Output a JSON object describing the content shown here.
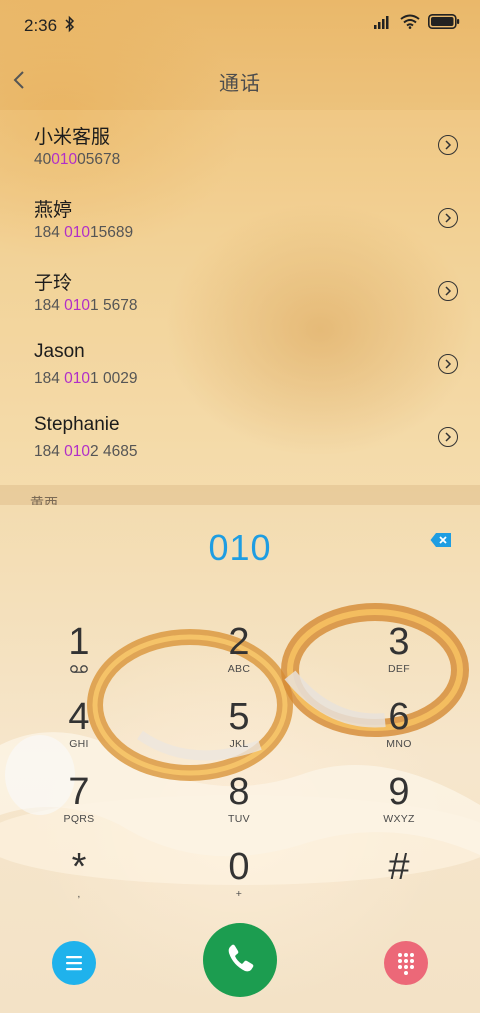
{
  "status_bar": {
    "time": "2:36"
  },
  "header": {
    "title": "通话"
  },
  "contacts": [
    {
      "name": "小米客服",
      "number_pre": "40",
      "number_match": "010",
      "number_post": "05678"
    },
    {
      "name": "燕婷",
      "number_pre": "184 ",
      "number_match": "010",
      "number_post": "15689"
    },
    {
      "name": "子玲",
      "number_pre": "184 ",
      "number_match": "010",
      "number_post": "1 5678"
    },
    {
      "name": "Jason",
      "number_pre": "184 ",
      "number_match": "010",
      "number_post": "1 0029"
    },
    {
      "name": "Stephanie",
      "number_pre": "184 ",
      "number_match": "010",
      "number_post": "2 4685"
    }
  ],
  "section_peek": "黄西",
  "dialer": {
    "display": "010",
    "keys": [
      {
        "digit": "1",
        "letters": ""
      },
      {
        "digit": "2",
        "letters": "ABC"
      },
      {
        "digit": "3",
        "letters": "DEF"
      },
      {
        "digit": "4",
        "letters": "GHI"
      },
      {
        "digit": "5",
        "letters": "JKL"
      },
      {
        "digit": "6",
        "letters": "MNO"
      },
      {
        "digit": "7",
        "letters": "PQRS"
      },
      {
        "digit": "8",
        "letters": "TUV"
      },
      {
        "digit": "9",
        "letters": "WXYZ"
      },
      {
        "digit": "*",
        "letters": ","
      },
      {
        "digit": "0",
        "letters": "+"
      },
      {
        "digit": "#",
        "letters": ""
      }
    ]
  },
  "colors": {
    "highlight": "#b12fc8",
    "display": "#1e9de2",
    "menu": "#1fb2ec",
    "call": "#1c9d50",
    "keypad_toggle": "#ec6878"
  },
  "icons": {
    "back": "chevron-left-icon",
    "detail": "chevron-right-circle-icon",
    "delete": "backspace-icon",
    "menu": "menu-icon",
    "call": "phone-icon",
    "keypad": "dialpad-icon",
    "voicemail": "voicemail-icon"
  }
}
